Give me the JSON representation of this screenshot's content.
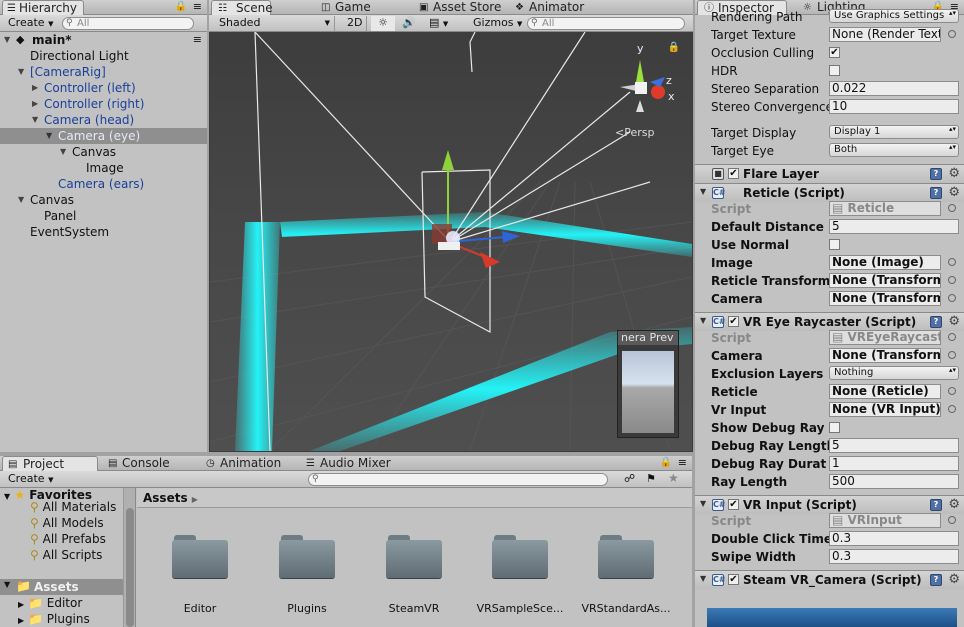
{
  "hierarchy": {
    "tab": "Hierarchy",
    "create_label": "Create",
    "search_placeholder": "All",
    "scene_name": "main*",
    "items": [
      {
        "label": "Directional Light",
        "color": "#111111"
      },
      {
        "label": "[CameraRig]",
        "color": "#1a3f9b"
      },
      {
        "label": "Controller (left)",
        "color": "#1a3f9b"
      },
      {
        "label": "Controller (right)",
        "color": "#1a3f9b"
      },
      {
        "label": "Camera (head)",
        "color": "#1a3f9b"
      },
      {
        "label": "Camera (eye)",
        "color": "#e5e9f6"
      },
      {
        "label": "Canvas",
        "color": "#111111"
      },
      {
        "label": "Image",
        "color": "#111111"
      },
      {
        "label": "Camera (ears)",
        "color": "#1a3f9b"
      },
      {
        "label": "Canvas",
        "color": "#111111"
      },
      {
        "label": "Panel",
        "color": "#111111"
      },
      {
        "label": "EventSystem",
        "color": "#111111"
      }
    ]
  },
  "scene": {
    "tabs": [
      "Scene",
      "Game",
      "Asset Store",
      "Animator"
    ],
    "shading_mode": "Shaded",
    "mode_2d": "2D",
    "gizmos_label": "Gizmos",
    "search_placeholder": "All",
    "persp_label": "Persp",
    "gizmo_axes": {
      "x": "x",
      "y": "y",
      "z": "z"
    },
    "camera_preview_title": "nera Prev",
    "accent_color": "#1fe7ec"
  },
  "project": {
    "tabs": [
      "Project",
      "Console",
      "Animation",
      "Audio Mixer"
    ],
    "create_label": "Create",
    "favorites_label": "Favorites",
    "favorites": [
      "All Materials",
      "All Models",
      "All Prefabs",
      "All Scripts"
    ],
    "assets_label": "Assets",
    "asset_folders": [
      "Editor",
      "Plugins"
    ],
    "breadcrumb": "Assets",
    "grid_items": [
      "Editor",
      "Plugins",
      "SteamVR",
      "VRSampleSce...",
      "VRStandardAs..."
    ]
  },
  "inspector": {
    "tabs": [
      "Inspector",
      "Lighting"
    ],
    "camera_fields": [
      {
        "label": "Rendering Path",
        "value": "Use Graphics Settings"
      },
      {
        "label": "Target Texture",
        "value": "None (Render Text"
      },
      {
        "label": "Occlusion Culling",
        "checked": true
      },
      {
        "label": "HDR",
        "checked": false
      },
      {
        "label": "Stereo Separation",
        "value": "0.022"
      },
      {
        "label": "Stereo Convergence",
        "value": "10"
      },
      {
        "label": "Target Display",
        "value": "Display 1"
      },
      {
        "label": "Target Eye",
        "value": "Both"
      }
    ],
    "flare_layer": "Flare Layer",
    "reticle": {
      "title": "Reticle (Script)",
      "script_label": "Script",
      "script_value": "Reticle",
      "default_distance_label": "Default Distance",
      "default_distance": "5",
      "use_normal_label": "Use Normal",
      "image_label": "Image",
      "image_value": "None (Image)",
      "reticle_transform_label": "Reticle Transform",
      "reticle_transform_value": "None (Transform",
      "camera_label": "Camera",
      "camera_value": "None (Transform"
    },
    "raycaster": {
      "title": "VR Eye Raycaster (Script)",
      "script_label": "Script",
      "script_value": "VREyeRaycaste",
      "camera_label": "Camera",
      "camera_value": "None (Transform",
      "exclusion_label": "Exclusion Layers",
      "exclusion_value": "Nothing",
      "reticle_label": "Reticle",
      "reticle_value": "None (Reticle)",
      "vr_input_label": "Vr Input",
      "vr_input_value": "None (VR Input)",
      "show_debug_label": "Show Debug Ray",
      "debug_length_label": "Debug Ray Length",
      "debug_length": "5",
      "debug_duration_label": "Debug Ray Duratio",
      "debug_duration": "1",
      "ray_length_label": "Ray Length",
      "ray_length": "500"
    },
    "vr_input": {
      "title": "VR Input (Script)",
      "script_label": "Script",
      "script_value": "VRInput",
      "double_click_label": "Double Click Time",
      "double_click": "0.3",
      "swipe_label": "Swipe Width",
      "swipe": "0.3"
    },
    "steam_camera": {
      "title": "Steam VR_Camera (Script)"
    }
  }
}
